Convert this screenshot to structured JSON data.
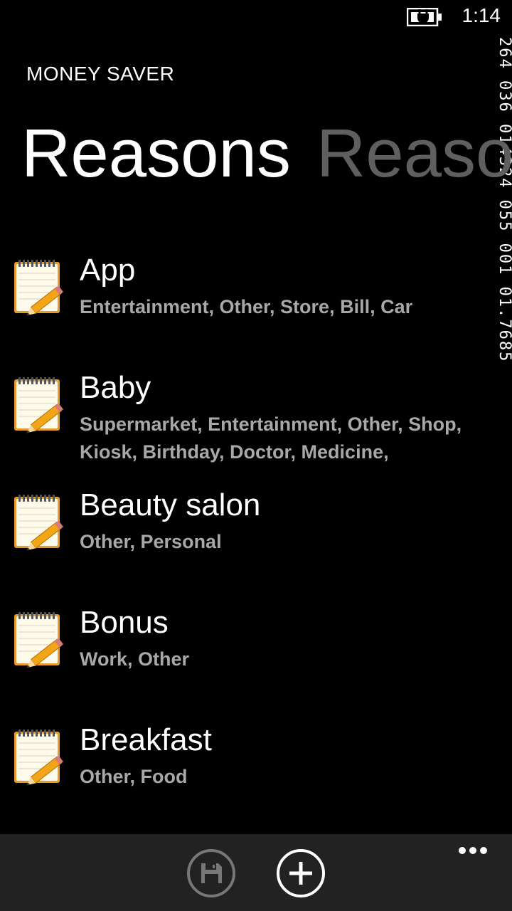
{
  "status": {
    "time": "1:14",
    "debug_counter": "264 036 014324 055 001 01.7685"
  },
  "app": {
    "title": "MONEY SAVER",
    "pivot_active": "Reasons",
    "pivot_next": "Reaso"
  },
  "reasons": [
    {
      "title": "App",
      "categories": "Entertainment, Other, Store, Bill, Car",
      "icon": "notepad-pencil-icon"
    },
    {
      "title": "Baby",
      "categories": "Supermarket, Entertainment, Other, Shop, Kiosk, Birthday, Doctor, Medicine,",
      "icon": "notepad-pencil-icon"
    },
    {
      "title": "Beauty salon",
      "categories": "Other, Personal",
      "icon": "notepad-pencil-icon"
    },
    {
      "title": "Bonus",
      "categories": "Work, Other",
      "icon": "notepad-pencil-icon"
    },
    {
      "title": "Breakfast",
      "categories": "Other, Food",
      "icon": "notepad-pencil-icon"
    }
  ],
  "appbar": {
    "buttons": [
      {
        "icon": "save-icon",
        "enabled": false
      },
      {
        "icon": "add-icon",
        "enabled": true
      }
    ],
    "more_icon": "ellipsis-icon"
  }
}
